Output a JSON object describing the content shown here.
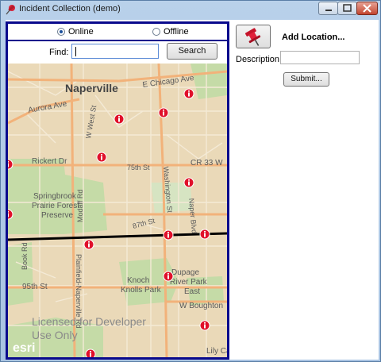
{
  "window": {
    "title": "Incident Collection (demo)"
  },
  "mode": {
    "options": [
      {
        "label": "Online",
        "selected": true
      },
      {
        "label": "Offline",
        "selected": false
      }
    ]
  },
  "find": {
    "label": "Find:",
    "value": "",
    "button_label": "Search"
  },
  "map": {
    "place_labels": [
      "Naperville",
      "E Chicago Ave",
      "Aurora Ave",
      "W West St",
      "Rickert Dr",
      "75th St",
      "CR 33 W",
      "Washington St",
      "Springbrook Prairie Forest Preserve",
      "Modaff Rd",
      "Naper Blvd",
      "87th St",
      "Book Rd",
      "95th St",
      "Plainfield-Naperville Rd",
      "Knoch Knolls Park",
      "Dupage River Park East",
      "W Boughton",
      "Lily Ca"
    ],
    "watermark": "Licensed for Developer Use Only",
    "logo": "esri",
    "incident_icon": "info-marker-icon",
    "incident_count": 13
  },
  "add_location": {
    "icon": "pushpin-icon",
    "label": "Add Location...",
    "description_label": "Description:",
    "description_value": "",
    "submit_label": "Submit..."
  },
  "colors": {
    "panel_border": "#0a0a8c",
    "incident_red": "#e0102a",
    "map_base": "#ead9b8",
    "park_green": "#c5dba7"
  }
}
